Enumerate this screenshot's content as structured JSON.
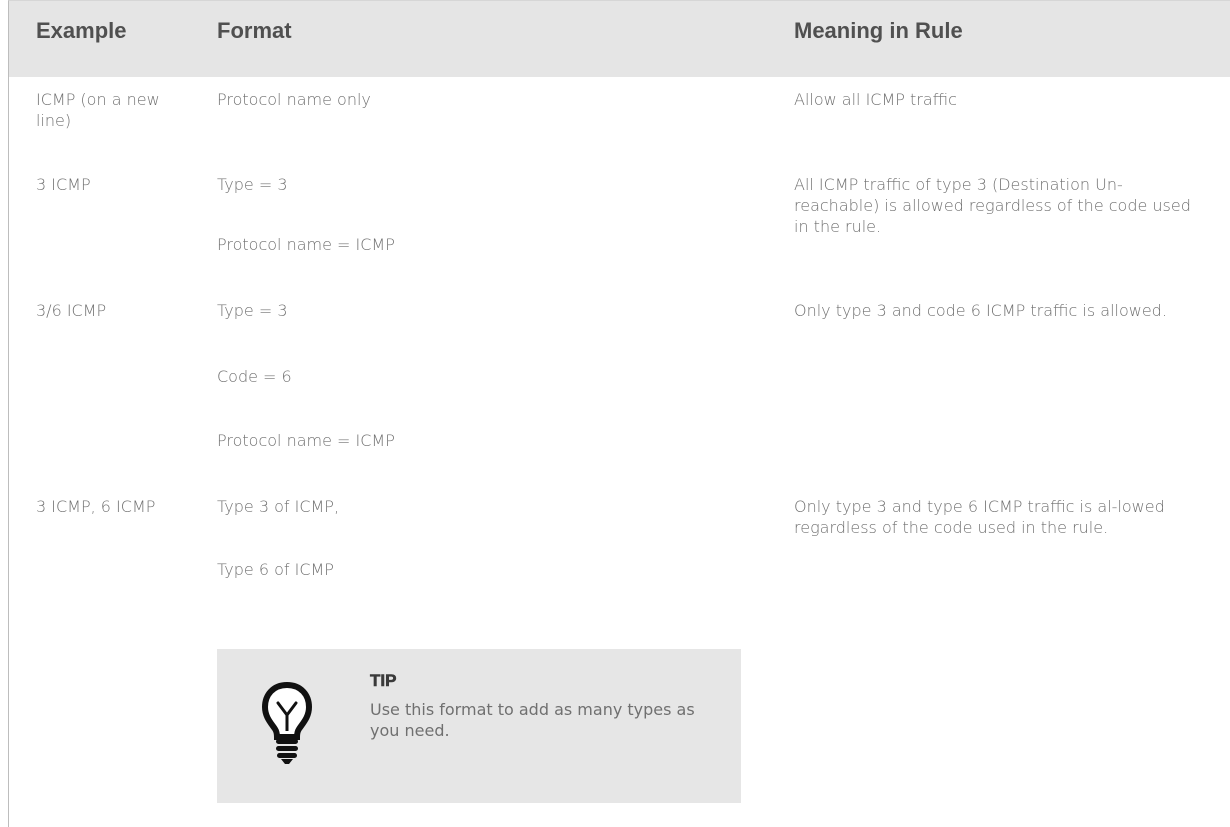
{
  "table": {
    "headers": {
      "example": "Example",
      "format": "Format",
      "meaning": "Meaning in Rule"
    },
    "rows": [
      {
        "example": "ICMP (on a new line)",
        "format": [
          "Protocol name only"
        ],
        "meaning": "Allow all ICMP traffic"
      },
      {
        "example": "3 ICMP",
        "format": [
          "Type = 3",
          "Protocol name = ICMP"
        ],
        "meaning": "All ICMP traffic of type 3 (Destination Un-reachable) is allowed regardless of the code used in the rule."
      },
      {
        "example": "3/6 ICMP",
        "format": [
          "Type = 3",
          "Code = 6",
          "Protocol name = ICMP"
        ],
        "meaning": "Only type 3 and code 6 ICMP traffic is allowed."
      },
      {
        "example": "3 ICMP, 6 ICMP",
        "format": [
          "Type 3 of ICMP,",
          "Type 6 of ICMP"
        ],
        "meaning": "Only type 3 and type 6 ICMP traffic is al-lowed regardless of the code used in the rule."
      }
    ]
  },
  "tip": {
    "title": "TIP",
    "text": "Use this format to add as many types as you need.",
    "icon": "lightbulb-icon"
  }
}
